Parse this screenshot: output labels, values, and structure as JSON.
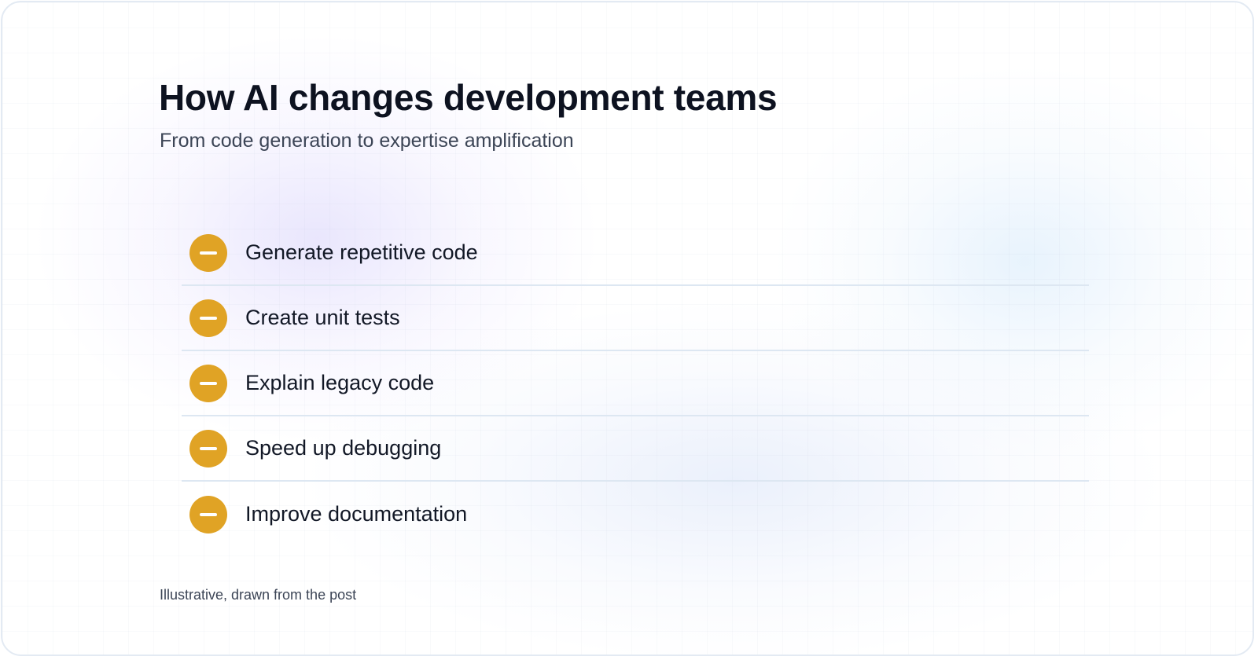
{
  "header": {
    "title": "How AI changes development teams",
    "subtitle": "From code generation to expertise amplification"
  },
  "items": [
    {
      "label": "Generate repetitive code",
      "icon": "minus-icon"
    },
    {
      "label": "Create unit tests",
      "icon": "minus-icon"
    },
    {
      "label": "Explain legacy code",
      "icon": "minus-icon"
    },
    {
      "label": "Speed up debugging",
      "icon": "minus-icon"
    },
    {
      "label": "Improve documentation",
      "icon": "minus-icon"
    }
  ],
  "footnote": "Illustrative, drawn from the post",
  "colors": {
    "badge": "#e0a325",
    "title": "#0d1220",
    "divider": "#dde7f2"
  }
}
